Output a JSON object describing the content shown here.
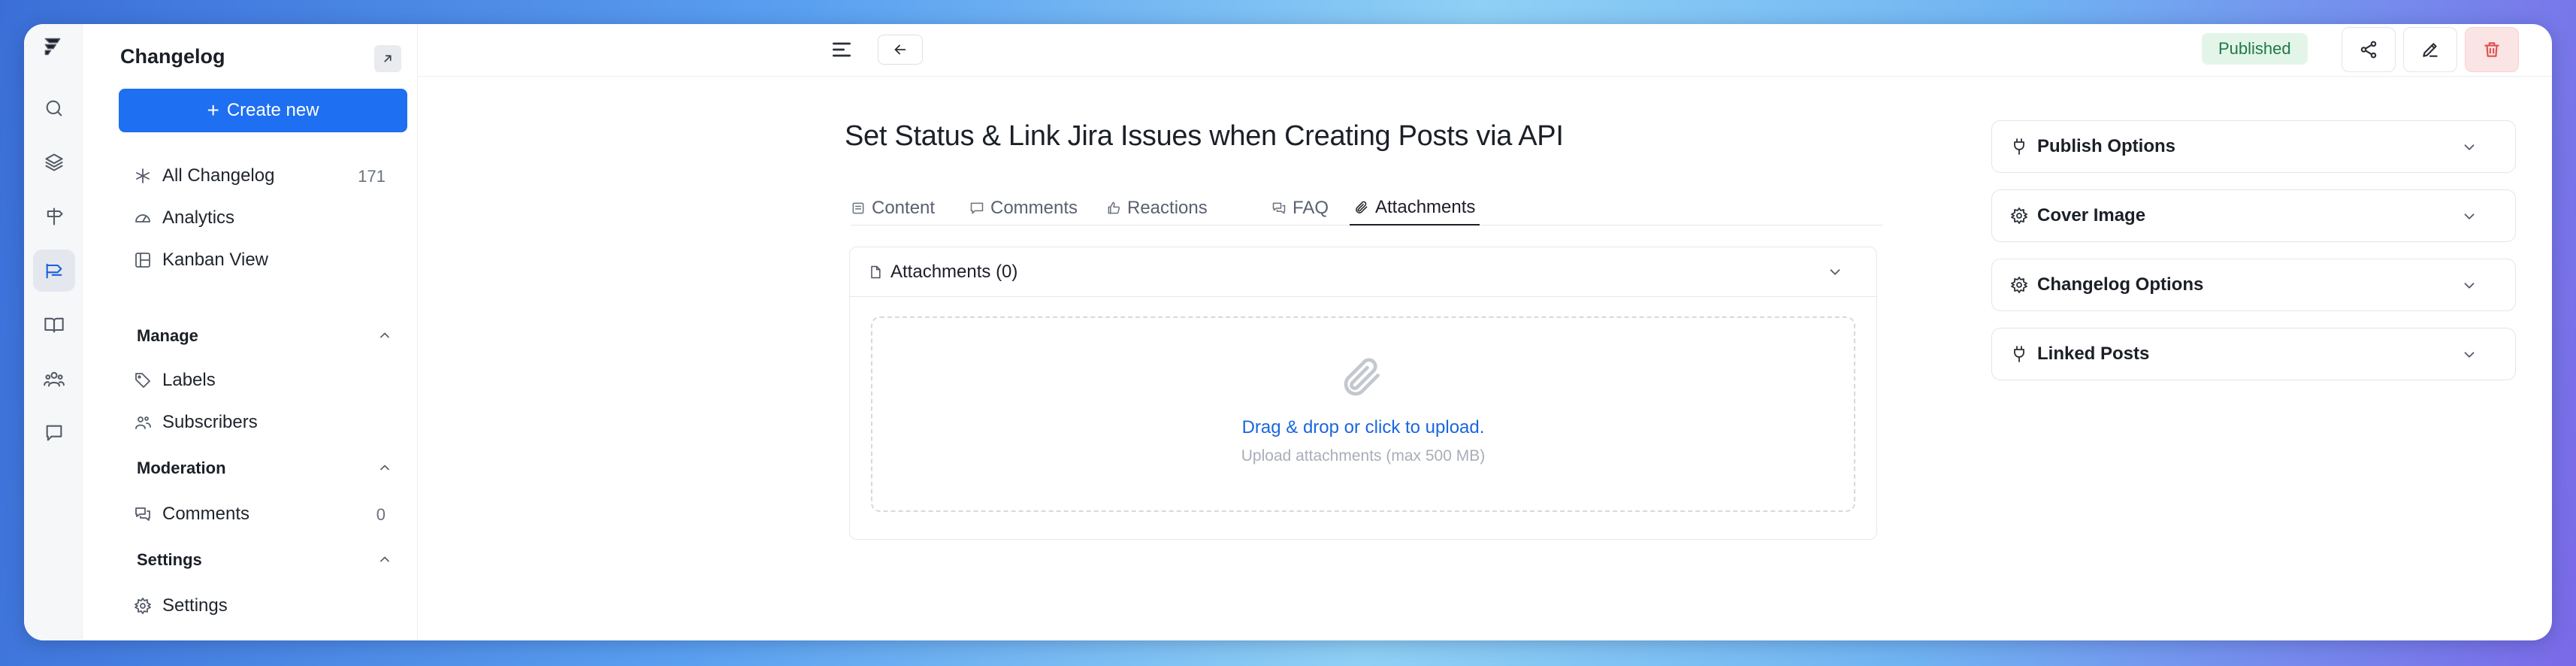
{
  "sidebar": {
    "title": "Changelog",
    "create_label": "Create new",
    "nav": [
      {
        "label": "All Changelog",
        "count": "171",
        "icon": "sparkle-icon"
      },
      {
        "label": "Analytics",
        "icon": "gauge-icon"
      },
      {
        "label": "Kanban View",
        "icon": "kanban-icon"
      }
    ],
    "manage": {
      "title": "Manage",
      "items": [
        {
          "label": "Labels"
        },
        {
          "label": "Subscribers"
        }
      ]
    },
    "moderation": {
      "title": "Moderation",
      "items": [
        {
          "label": "Comments",
          "count": "0"
        }
      ]
    },
    "settings": {
      "title": "Settings",
      "items": [
        {
          "label": "Settings"
        }
      ]
    }
  },
  "topbar": {
    "status": "Published"
  },
  "post": {
    "title": "Set Status & Link Jira Issues when Creating Posts via API",
    "tabs": [
      {
        "label": "Content"
      },
      {
        "label": "Comments"
      },
      {
        "label": "Reactions"
      },
      {
        "label": "FAQ"
      },
      {
        "label": "Attachments"
      }
    ],
    "active_tab": "Attachments"
  },
  "attachments": {
    "header": "Attachments (0)",
    "drop_text": "Drag & drop or click to upload.",
    "hint": "Upload attachments (max 500 MB)"
  },
  "right_panel": {
    "sections": [
      {
        "label": "Publish Options",
        "icon": "plug-icon"
      },
      {
        "label": "Cover Image",
        "icon": "gear-icon"
      },
      {
        "label": "Changelog Options",
        "icon": "gear-icon"
      },
      {
        "label": "Linked Posts",
        "icon": "plug-icon"
      }
    ]
  },
  "colors": {
    "accent": "#1e6ff1",
    "published_bg": "#e3f5e9",
    "published_text": "#1e7a45",
    "danger": "#e05050"
  }
}
